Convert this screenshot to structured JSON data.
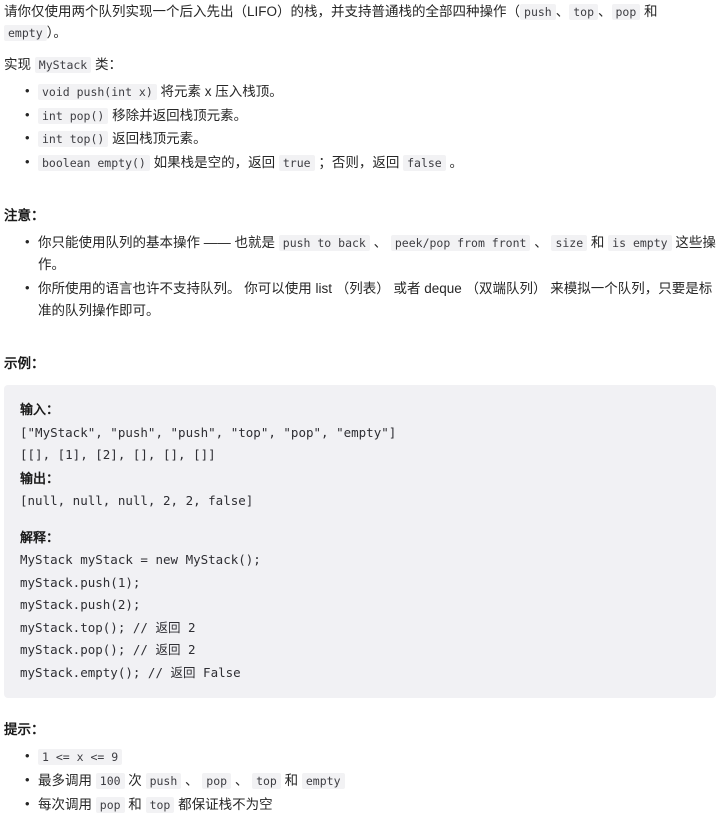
{
  "problem": {
    "intro_pre": "请你仅使用两个队列实现一个后入先出（LIFO）的栈，并支持普通栈的全部四种操作（",
    "intro_codes": [
      "push",
      "top",
      "pop",
      "empty"
    ],
    "intro_sep1": "、",
    "intro_sep2": "、",
    "intro_and": " 和 ",
    "intro_post": "）。",
    "implement_pre": "实现 ",
    "implement_code": "MyStack",
    "implement_post": " 类：",
    "methods": [
      {
        "code": "void push(int x)",
        "desc": " 将元素 x 压入栈顶。"
      },
      {
        "code": "int pop()",
        "desc": " 移除并返回栈顶元素。"
      },
      {
        "code": "int top()",
        "desc": " 返回栈顶元素。"
      },
      {
        "code": "boolean empty()",
        "desc_a": " 如果栈是空的，返回 ",
        "code_b": "true",
        "desc_b": " ；否则，返回 ",
        "code_c": "false",
        "desc_c": " 。"
      }
    ]
  },
  "notes": {
    "heading": "注意：",
    "items": [
      {
        "pre": "你只能使用队列的基本操作 —— 也就是 ",
        "codes": [
          "push to back",
          "peek/pop from front",
          "size",
          "is empty"
        ],
        "sep1": " 、 ",
        "sep2": " 、 ",
        "and": " 和 ",
        "post": " 这些操作。"
      },
      {
        "text": "你所使用的语言也许不支持队列。 你可以使用 list （列表） 或者 deque （双端队列） 来模拟一个队列，只要是标准的队列操作即可。"
      }
    ]
  },
  "example": {
    "heading": "示例：",
    "input_label": "输入：",
    "input_lines": [
      "[\"MyStack\", \"push\", \"push\", \"top\", \"pop\", \"empty\"]",
      "[[], [1], [2], [], [], []]"
    ],
    "output_label": "输出：",
    "output_lines": [
      "[null, null, null, 2, 2, false]"
    ],
    "explain_label": "解释：",
    "explain_lines": [
      "MyStack myStack = new MyStack();",
      "myStack.push(1);",
      "myStack.push(2);",
      "myStack.top(); // 返回 2",
      "myStack.pop(); // 返回 2",
      "myStack.empty(); // 返回 False"
    ]
  },
  "hints": {
    "heading": "提示：",
    "items": [
      {
        "kind": "code_only",
        "code": "1 <= x <= 9"
      },
      {
        "kind": "mixed",
        "pre": "最多调用 ",
        "count": "100",
        "mid": " 次 ",
        "codes": [
          "push",
          "pop",
          "top",
          "empty"
        ],
        "sep1": " 、 ",
        "sep2": " 、 ",
        "and": " 和 "
      },
      {
        "kind": "mixed2",
        "pre": "每次调用 ",
        "code_a": "pop",
        "mid": " 和 ",
        "code_b": "top",
        "post": " 都保证栈不为空"
      }
    ]
  },
  "colors": {
    "page_bg": "#ffffff",
    "text": "#262626",
    "code_bg": "#f2f2f4",
    "code_text": "#3d3d42",
    "box_bg": "#f1f1f4"
  }
}
